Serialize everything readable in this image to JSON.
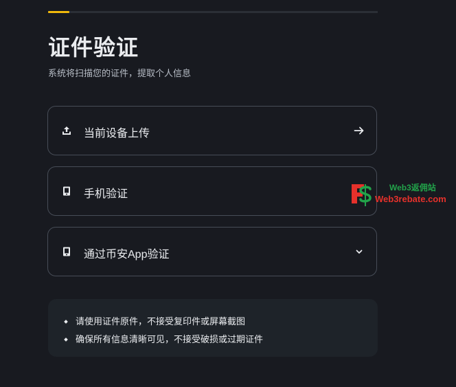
{
  "progress": {
    "completed_fraction": 0.065,
    "accent_color": "#f0b90b"
  },
  "header": {
    "title": "证件验证",
    "subtitle": "系统将扫描您的证件，提取个人信息"
  },
  "options": [
    {
      "label": "当前设备上传",
      "icon": "upload-icon",
      "trail_icon": "arrow-right-icon"
    },
    {
      "label": "手机验证",
      "icon": "mobile-phone-icon",
      "trail_icon": "none"
    },
    {
      "label": "通过币安App验证",
      "icon": "mobile-phone-icon",
      "trail_icon": "chevron-down-icon"
    }
  ],
  "notes": [
    "请使用证件原件，不接受复印件或屏幕截图",
    "确保所有信息清晰可见，不接受破损或过期证件"
  ],
  "watermark": {
    "line1": "Web3返佣站",
    "line2": "Web3rebate.com"
  }
}
